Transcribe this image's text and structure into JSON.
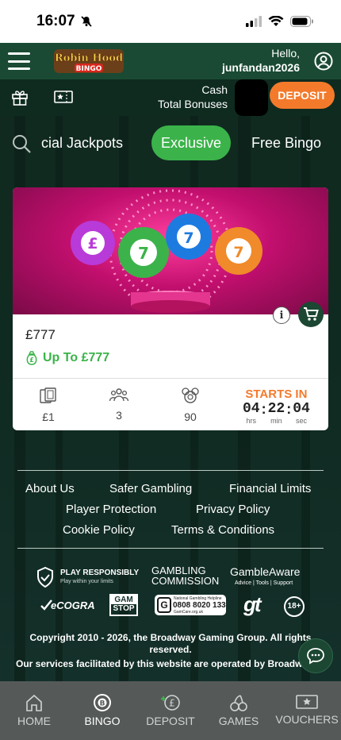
{
  "status_bar": {
    "time": "16:07"
  },
  "header": {
    "greeting": "Hello,",
    "username": "junfandan2026"
  },
  "balance": {
    "cash_label": "Cash",
    "bonus_label": "Total Bonuses",
    "deposit_label": "DEPOSIT"
  },
  "tabs": [
    {
      "label": "cial Jackpots"
    },
    {
      "label": "Exclusive",
      "active": true
    },
    {
      "label": "Free Bingo"
    }
  ],
  "game_card": {
    "title": "£777",
    "prize": "Up To £777",
    "ticket_price": "£1",
    "players": "3",
    "ball_type": "90",
    "starts_label": "STARTS IN",
    "countdown": {
      "hrs": "04",
      "min": "22",
      "sec": "04",
      "hrs_label": "hrs",
      "min_label": "min",
      "sec_label": "sec"
    },
    "balls": [
      {
        "label": "£",
        "color": "#b83ad8"
      },
      {
        "label": "7",
        "color": "#3bb34a"
      },
      {
        "label": "7",
        "color": "#1d7be0"
      },
      {
        "label": "7",
        "color": "#f08a2a"
      }
    ]
  },
  "footer": {
    "links_row1": [
      "About Us",
      "Safer Gambling",
      "Financial Limits"
    ],
    "links_row2": [
      "Player Protection",
      "Privacy Policy"
    ],
    "links_row3": [
      "Cookie Policy",
      "Terms & Conditions"
    ],
    "play_responsibly": "PLAY RESPONSIBLY",
    "play_responsibly_sub": "Play within your limits",
    "gambling_commission_1": "GAMBLING",
    "gambling_commission_2": "COMMISSION",
    "gambleaware": "GambleAware",
    "gambleaware_sub": "Advice | Tools | Support",
    "ecogra": "eCOGRA",
    "gamstop_1": "GAM",
    "gamstop_2": "STOP",
    "helpline_label": "National Gambling Helpline",
    "helpline_number": "0808 8020 133",
    "helpline_site": "GamCare.org.uk",
    "gt": "gt",
    "age": "18+",
    "copyright": "Copyright 2010 - 2026, the Broadway Gaming Group. All rights reserved.",
    "operated": "Our services facilitated by this website are operated by Broadway Gaming Ireland DF Limited, a company incorporated in the Republic of"
  },
  "bottom_nav": [
    {
      "label": "HOME",
      "icon": "home-icon"
    },
    {
      "label": "BINGO",
      "icon": "bingo-ball-icon",
      "active": true
    },
    {
      "label": "DEPOSIT",
      "icon": "deposit-icon"
    },
    {
      "label": "GAMES",
      "icon": "cherries-icon"
    },
    {
      "label": "VOUCHERS",
      "icon": "ticket-icon"
    }
  ]
}
